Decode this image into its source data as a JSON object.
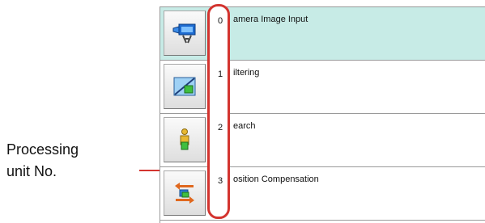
{
  "callout": {
    "line1": "Processing",
    "line2": "unit No."
  },
  "colors": {
    "highlight": "#d3342f",
    "selected_row": "#c7ebe6"
  },
  "units": [
    {
      "no": "0",
      "name": "amera Image Input",
      "icon": "camera-icon",
      "selected": true
    },
    {
      "no": "1",
      "name": "iltering",
      "icon": "filter-icon",
      "selected": false
    },
    {
      "no": "2",
      "name": "earch",
      "icon": "search-person-icon",
      "selected": false
    },
    {
      "no": "3",
      "name": "osition Compensation",
      "icon": "position-compensation-icon",
      "selected": false
    }
  ]
}
